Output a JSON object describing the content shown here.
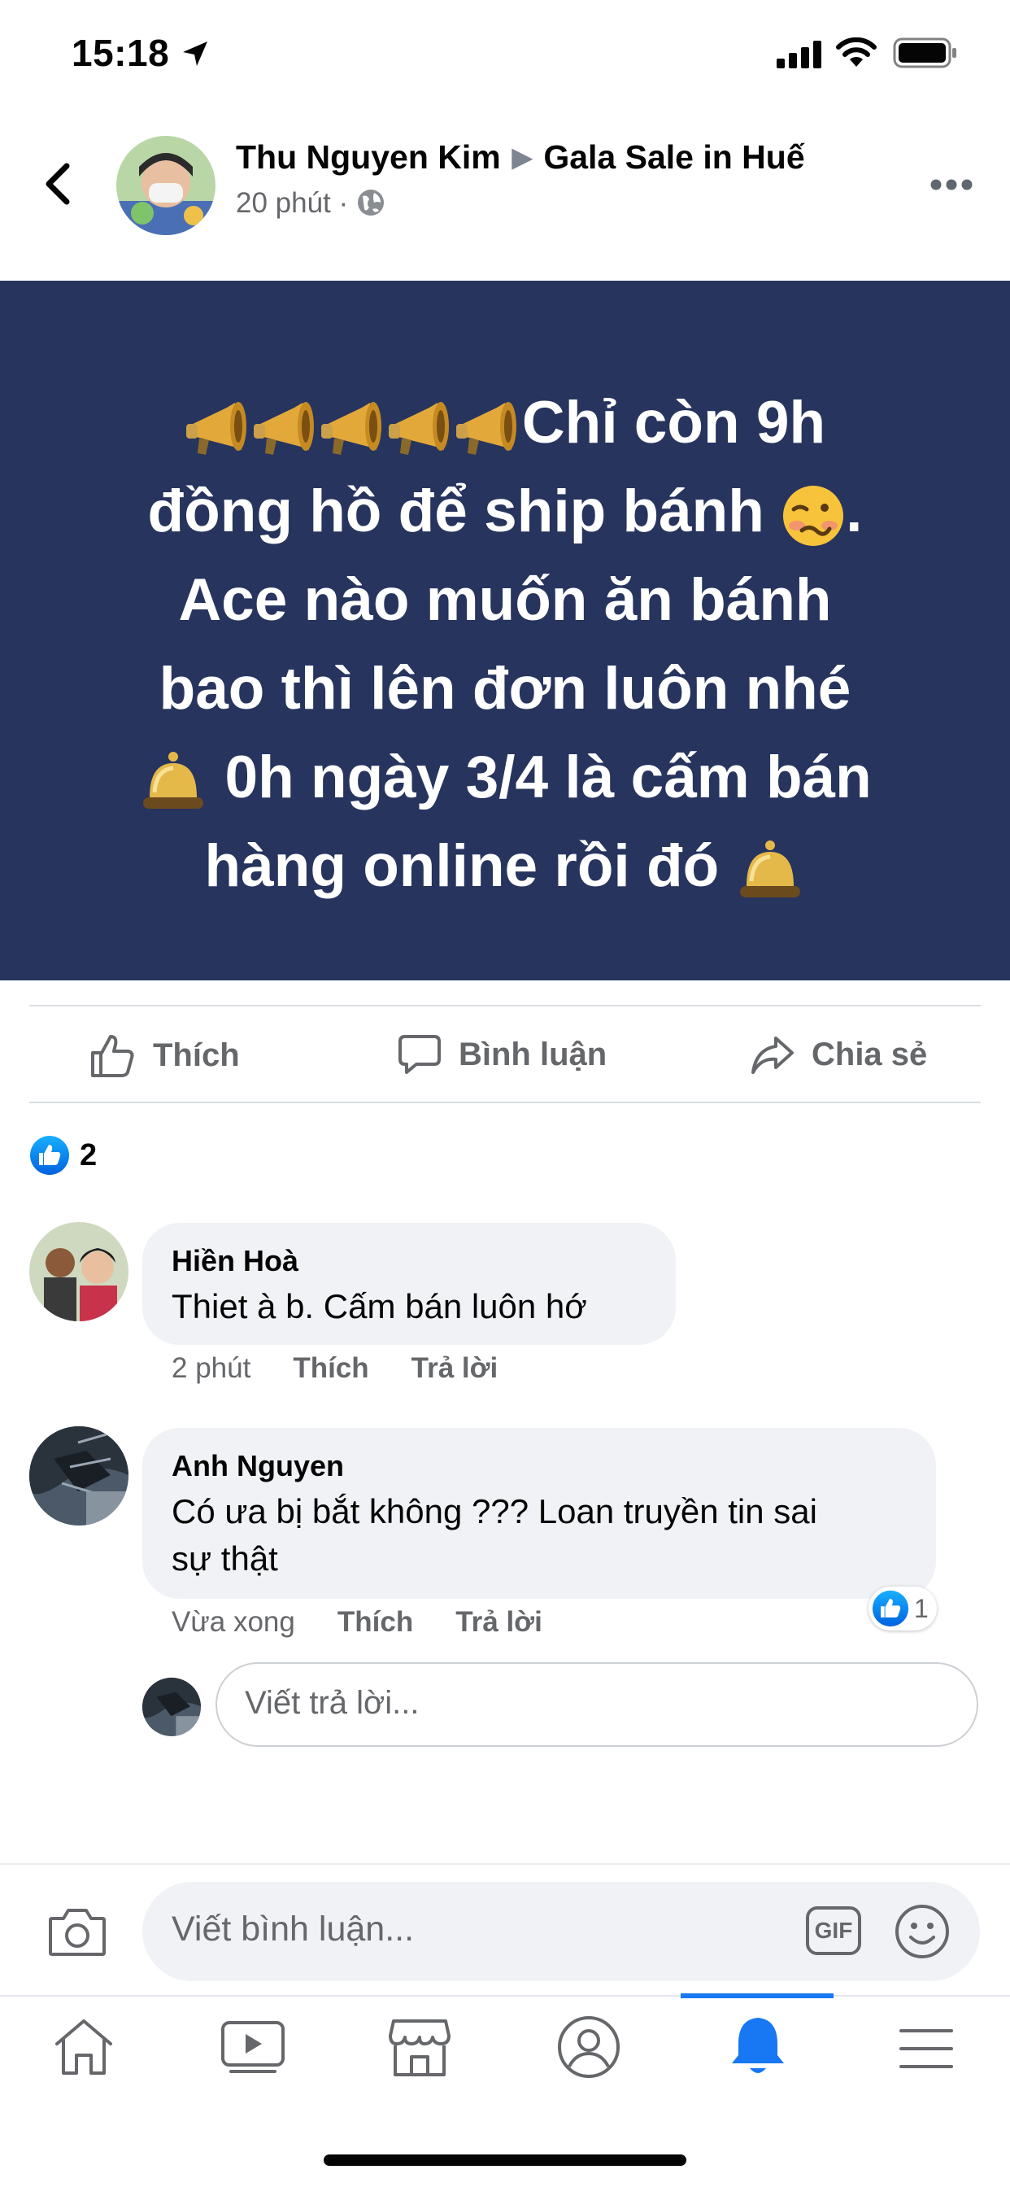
{
  "status_bar": {
    "time": "15:18"
  },
  "post": {
    "author": "Thu Nguyen Kim",
    "group": "Gala Sale in Huế",
    "time_ago": "20 phút",
    "lines": [
      {
        "pre_emoji": [
          "megaphone",
          "megaphone",
          "megaphone",
          "megaphone",
          "megaphone"
        ],
        "text": "Chỉ còn 9h",
        "post_emoji": []
      },
      {
        "pre_emoji": [],
        "text": "đồng hồ để ship bánh ",
        "post_emoji": [
          "woozy-face"
        ],
        "tail": "."
      },
      {
        "pre_emoji": [],
        "text": "Ace nào muốn ăn bánh",
        "post_emoji": []
      },
      {
        "pre_emoji": [],
        "text": "bao thì lên đơn luôn nhé",
        "post_emoji": []
      },
      {
        "pre_emoji": [
          "bell"
        ],
        "text": " 0h ngày 3/4 là cấm bán",
        "post_emoji": []
      },
      {
        "pre_emoji": [],
        "text": "hàng online rồi đó ",
        "post_emoji": [
          "bell"
        ]
      }
    ],
    "banner_color": "#27345e"
  },
  "actions": {
    "like": "Thích",
    "comment": "Bình luận",
    "share": "Chia sẻ"
  },
  "reactions": {
    "count": "2"
  },
  "comments": [
    {
      "name": "Hiền Hoà",
      "text": "Thiet à b. Cấm bán luôn hớ",
      "time": "2 phút",
      "like": "Thích",
      "reply": "Trả lời"
    },
    {
      "name": "Anh Nguyen",
      "text_line1": "Có ưa bị bắt không ??? Loan truyền tin sai",
      "text_line2": "sự thật",
      "time": "Vừa xong",
      "like": "Thích",
      "reply": "Trả lời",
      "reaction_count": "1"
    }
  ],
  "reply_input": {
    "placeholder": "Viết trả lời..."
  },
  "comment_input": {
    "placeholder": "Viết bình luận...",
    "gif": "GIF"
  },
  "accent_color": "#1877f2"
}
